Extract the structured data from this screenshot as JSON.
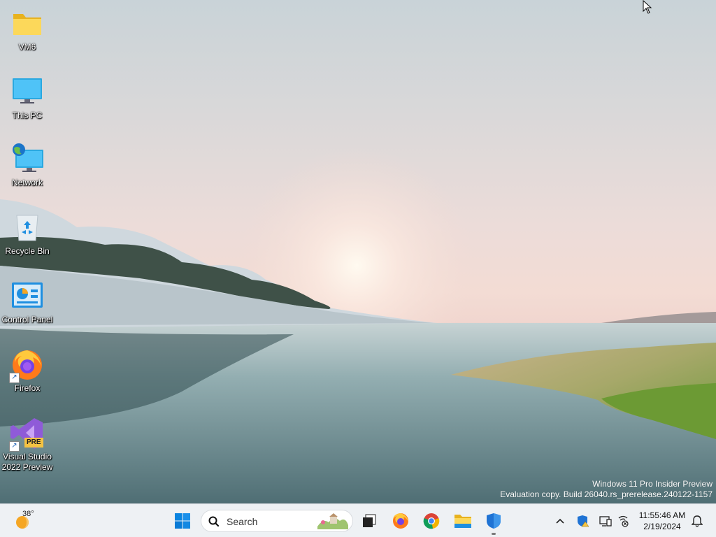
{
  "desktop": {
    "icons": [
      {
        "id": "vm6",
        "label": "VM6"
      },
      {
        "id": "this-pc",
        "label": "This PC"
      },
      {
        "id": "network",
        "label": "Network"
      },
      {
        "id": "recycle-bin",
        "label": "Recycle Bin"
      },
      {
        "id": "control-panel",
        "label": "Control Panel"
      },
      {
        "id": "firefox",
        "label": "Firefox"
      },
      {
        "id": "visual-studio",
        "label": "Visual Studio\n2022 Preview",
        "badge": "PRE"
      }
    ],
    "watermark": {
      "line1": "Windows 11 Pro Insider Preview",
      "line2": "Evaluation copy. Build 26040.rs_prerelease.240122-1157"
    }
  },
  "taskbar": {
    "weather": {
      "temp": "38°"
    },
    "search": {
      "placeholder": "Search"
    },
    "apps": [
      "start-icon",
      "task-view-icon",
      "firefox-icon",
      "chrome-icon",
      "file-explorer-icon",
      "windows-security-icon"
    ],
    "tray": {
      "time": "11:55:46 AM",
      "date": "2/19/2024"
    },
    "colors": {
      "accent": "#0078d4",
      "taskbar_bg": "#eef1f4"
    }
  }
}
